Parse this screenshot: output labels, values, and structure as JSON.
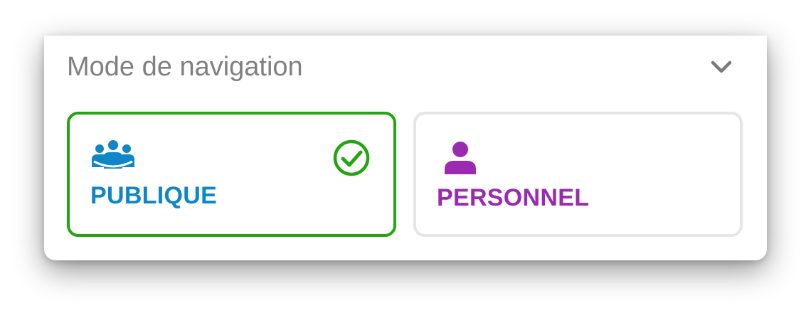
{
  "header": {
    "title": "Mode de navigation",
    "toggle_icon": "chevron-down-icon"
  },
  "options": [
    {
      "label": "PUBLIQUE",
      "icon": "group-icon",
      "selected": true,
      "selected_icon": "check-circle-icon",
      "accent_color": "#0f86c8",
      "border_color": "#22a511"
    },
    {
      "label": "PERSONNEL",
      "icon": "person-icon",
      "selected": false,
      "accent_color": "#9a2ab0",
      "border_color": "#e6e6e6"
    }
  ]
}
